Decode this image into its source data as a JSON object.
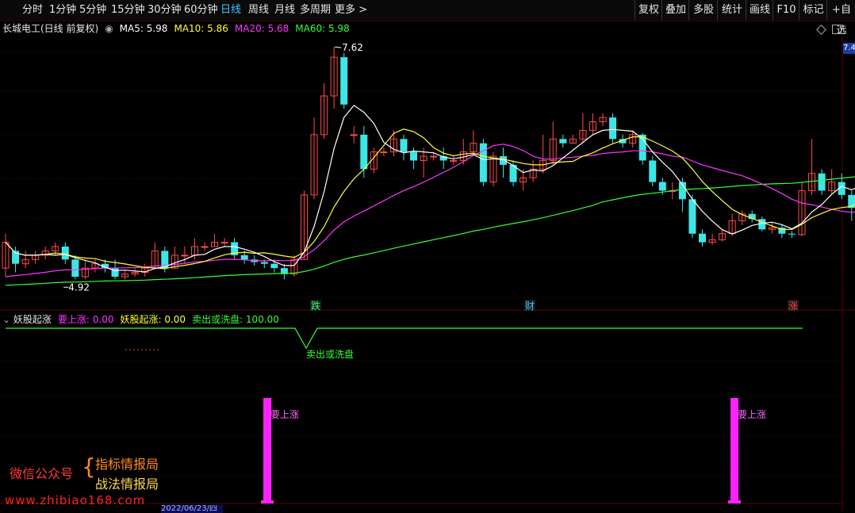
{
  "toolbar": {
    "periods": [
      "分时",
      "1分钟",
      "5分钟",
      "15分钟",
      "30分钟",
      "60分钟",
      "日线",
      "周线",
      "月线",
      "多周期",
      "更多 >"
    ],
    "active": "日线",
    "right": [
      "复权",
      "叠加",
      "多股",
      "统计",
      "画线",
      "F10",
      "标记",
      "+自选"
    ]
  },
  "stock": {
    "title": "长城电工(日线 前复权)",
    "ma": [
      {
        "label": "MA5: 5.98",
        "color": "#ffffff"
      },
      {
        "label": "MA10: 5.86",
        "color": "#ffff33"
      },
      {
        "label": "MA20: 5.68",
        "color": "#ff33ff"
      },
      {
        "label": "MA60: 5.98",
        "color": "#33ff33"
      }
    ],
    "high_label": "7.62",
    "low_label": "4.92",
    "axis_right": "7.4",
    "markers": [
      {
        "text": "跌",
        "color": "#33ff66"
      },
      {
        "text": "财",
        "color": "#3cc8ff"
      },
      {
        "text": "涨",
        "color": "#ff4040"
      }
    ]
  },
  "indicator": {
    "name": "妖股起涨",
    "values": [
      {
        "label": "要上涨: 0.00",
        "color": "#ff33ff"
      },
      {
        "label": "妖股起涨: 0.00",
        "color": "#ffff33"
      },
      {
        "label": "卖出或洗盘: 100.00",
        "color": "#33ff33"
      }
    ],
    "sell_label": "卖出或洗盘",
    "up_label": "要上涨"
  },
  "watermark": {
    "wechat": "微信公众号",
    "brand1": "指标情报局",
    "brand2": "战法情报局",
    "site": "www.zhibiao168.com"
  },
  "footer": {
    "date": "2022/06/23/四"
  },
  "chart_data": {
    "type": "candlestick",
    "title": "长城电工(日线 前复权)",
    "candles": [
      [
        5.05,
        5.35,
        5.45,
        4.95
      ],
      [
        5.25,
        5.1,
        5.3,
        5.0
      ],
      [
        5.1,
        5.15,
        5.25,
        5.05
      ],
      [
        5.15,
        5.2,
        5.25,
        5.1
      ],
      [
        5.2,
        5.25,
        5.3,
        5.15
      ],
      [
        5.25,
        5.3,
        5.35,
        5.2
      ],
      [
        5.3,
        5.15,
        5.35,
        5.1
      ],
      [
        5.15,
        4.95,
        5.2,
        4.92
      ],
      [
        4.95,
        5.05,
        5.15,
        4.92
      ],
      [
        5.05,
        5.1,
        5.15,
        5.0
      ],
      [
        5.1,
        5.05,
        5.15,
        5.0
      ],
      [
        5.05,
        4.95,
        5.15,
        4.92
      ],
      [
        4.95,
        4.98,
        5.02,
        4.92
      ],
      [
        4.98,
        5.0,
        5.05,
        4.95
      ],
      [
        5.0,
        5.05,
        5.1,
        4.95
      ],
      [
        5.05,
        5.25,
        5.35,
        5.05
      ],
      [
        5.25,
        5.05,
        5.3,
        5.0
      ],
      [
        5.05,
        5.2,
        5.3,
        5.05
      ],
      [
        5.2,
        5.2,
        5.3,
        5.1
      ],
      [
        5.2,
        5.3,
        5.4,
        5.15
      ],
      [
        5.3,
        5.3,
        5.35,
        5.25
      ],
      [
        5.3,
        5.35,
        5.45,
        5.3
      ],
      [
        5.35,
        5.35,
        5.4,
        5.3
      ],
      [
        5.35,
        5.2,
        5.4,
        5.15
      ],
      [
        5.2,
        5.15,
        5.25,
        5.1
      ],
      [
        5.15,
        5.12,
        5.2,
        5.08
      ],
      [
        5.12,
        5.1,
        5.15,
        5.05
      ],
      [
        5.1,
        5.05,
        5.15,
        5.0
      ],
      [
        5.05,
        4.98,
        5.1,
        4.92
      ],
      [
        4.98,
        5.15,
        5.2,
        4.95
      ],
      [
        5.15,
        5.9,
        5.95,
        5.15
      ],
      [
        5.9,
        6.6,
        6.8,
        5.85
      ],
      [
        6.6,
        7.05,
        7.2,
        6.55
      ],
      [
        7.05,
        7.5,
        7.62,
        6.9
      ],
      [
        7.5,
        6.95,
        7.55,
        6.9
      ],
      [
        6.6,
        6.6,
        6.7,
        6.5
      ],
      [
        6.6,
        6.2,
        6.7,
        6.1
      ],
      [
        6.2,
        6.4,
        6.45,
        6.15
      ],
      [
        6.4,
        6.4,
        6.45,
        6.35
      ],
      [
        6.4,
        6.55,
        6.65,
        6.35
      ],
      [
        6.55,
        6.4,
        6.6,
        6.3
      ],
      [
        6.4,
        6.3,
        6.45,
        6.2
      ],
      [
        6.3,
        6.35,
        6.45,
        6.1
      ],
      [
        6.35,
        6.35,
        6.4,
        6.3
      ],
      [
        6.35,
        6.3,
        6.45,
        6.2
      ],
      [
        6.3,
        6.3,
        6.35,
        6.25
      ],
      [
        6.3,
        6.4,
        6.55,
        6.25
      ],
      [
        6.4,
        6.5,
        6.65,
        6.35
      ],
      [
        6.5,
        6.05,
        6.55,
        6.0
      ],
      [
        6.05,
        6.35,
        6.4,
        6.0
      ],
      [
        6.35,
        6.25,
        6.45,
        6.1
      ],
      [
        6.25,
        6.05,
        6.3,
        6.0
      ],
      [
        6.05,
        6.1,
        6.2,
        5.95
      ],
      [
        6.1,
        6.2,
        6.3,
        6.05
      ],
      [
        6.2,
        6.3,
        6.6,
        6.15
      ],
      [
        6.3,
        6.55,
        6.75,
        6.25
      ],
      [
        6.55,
        6.5,
        6.6,
        6.45
      ],
      [
        6.5,
        6.55,
        6.6,
        6.5
      ],
      [
        6.55,
        6.65,
        6.85,
        6.5
      ],
      [
        6.65,
        6.75,
        6.85,
        6.6
      ],
      [
        6.75,
        6.8,
        6.85,
        6.7
      ],
      [
        6.8,
        6.55,
        6.85,
        6.5
      ],
      [
        6.55,
        6.5,
        6.6,
        6.45
      ],
      [
        6.5,
        6.6,
        6.65,
        6.45
      ],
      [
        6.6,
        6.3,
        6.62,
        6.25
      ],
      [
        6.3,
        6.05,
        6.35,
        6.0
      ],
      [
        6.05,
        5.95,
        6.1,
        5.9
      ],
      [
        5.95,
        5.95,
        6.05,
        5.85
      ],
      [
        6.05,
        5.85,
        6.1,
        5.7
      ],
      [
        5.85,
        5.45,
        5.9,
        5.4
      ],
      [
        5.45,
        5.35,
        5.5,
        5.3
      ],
      [
        5.35,
        5.38,
        5.45,
        5.32
      ],
      [
        5.38,
        5.45,
        5.5,
        5.36
      ],
      [
        5.45,
        5.6,
        5.68,
        5.42
      ],
      [
        5.6,
        5.68,
        5.72,
        5.55
      ],
      [
        5.68,
        5.62,
        5.72,
        5.58
      ],
      [
        5.62,
        5.5,
        5.65,
        5.48
      ],
      [
        5.5,
        5.52,
        5.58,
        5.45
      ],
      [
        5.52,
        5.45,
        5.55,
        5.4
      ],
      [
        5.45,
        5.44,
        5.48,
        5.4
      ],
      [
        5.44,
        5.95,
        6.05,
        5.42
      ],
      [
        5.95,
        6.15,
        6.55,
        5.9
      ],
      [
        6.15,
        5.95,
        6.2,
        5.9
      ],
      [
        5.95,
        6.05,
        6.2,
        5.92
      ],
      [
        6.05,
        5.9,
        6.15,
        5.85
      ],
      [
        5.9,
        5.75,
        5.95,
        5.6
      ],
      [
        5.75,
        6.4,
        6.45,
        5.7
      ],
      [
        6.4,
        6.6,
        6.8,
        6.35
      ]
    ],
    "ylim": [
      4.6,
      7.75
    ]
  }
}
